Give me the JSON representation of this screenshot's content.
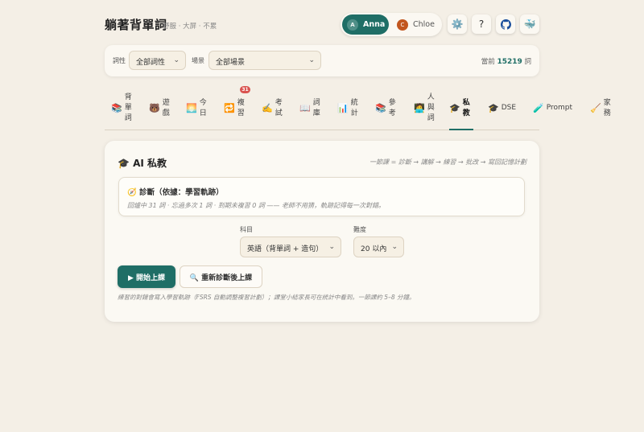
{
  "header": {
    "title": "躺著背單詞",
    "subtitle": "舒服 · 大屏 · 不累",
    "users": [
      {
        "initial": "A",
        "name": "Anna",
        "active": true
      },
      {
        "initial": "C",
        "name": "Chloe",
        "active": false
      }
    ],
    "icons": [
      "gear-icon",
      "help-icon",
      "github-icon",
      "docker-icon"
    ],
    "help_label": "?"
  },
  "filters": {
    "pos_label": "詞性",
    "pos_value": "全部詞性",
    "scene_label": "場景",
    "scene_value": "全部場景",
    "count_prefix": "當前",
    "count_value": "15219",
    "count_suffix": "詞"
  },
  "tabs": [
    {
      "icon": "📚",
      "label": "背單詞"
    },
    {
      "icon": "🐻",
      "label": "遊戲"
    },
    {
      "icon": "🌅",
      "label": "今日"
    },
    {
      "icon": "🔁",
      "label": "複習",
      "badge": "31"
    },
    {
      "icon": "✍️",
      "label": "考試"
    },
    {
      "icon": "📖",
      "label": "詞庫"
    },
    {
      "icon": "📊",
      "label": "統計"
    },
    {
      "icon": "📚",
      "label": "參考"
    },
    {
      "icon": "🧑‍💻",
      "label": "人與詞"
    },
    {
      "icon": "🎓",
      "label": "私教",
      "active": true
    },
    {
      "icon": "🎓",
      "label": "DSE"
    },
    {
      "icon": "🧪",
      "label": "Prompt"
    },
    {
      "icon": "🧹",
      "label": "家務"
    }
  ],
  "tutor": {
    "title": "🎓 AI 私教",
    "flow": "一節課 = 診斷 → 講解 → 練習 → 批改 → 寫回記憶計劃",
    "diag_title": "🧭 診斷（依據：學習軌跡）",
    "diag_text": "回爐中 31 詞 · 忘過多次 1 詞 · 到期未複習 0 詞 —— 老師不用猜，軌跡記得每一次對錯。",
    "subject_label": "科目",
    "subject_value": "英語（背單詞 + 造句）",
    "difficulty_label": "難度",
    "difficulty_value": "20 以內",
    "start_button": "▶ 開始上課",
    "rediagnose_button": "🔍 重新診斷後上課",
    "footnote": "練習的對錯會寫入學習軌跡（FSRS 自動調整複習計劃）；課堂小結家長可在統計中看到。一節課約 5–8 分鐘。"
  }
}
